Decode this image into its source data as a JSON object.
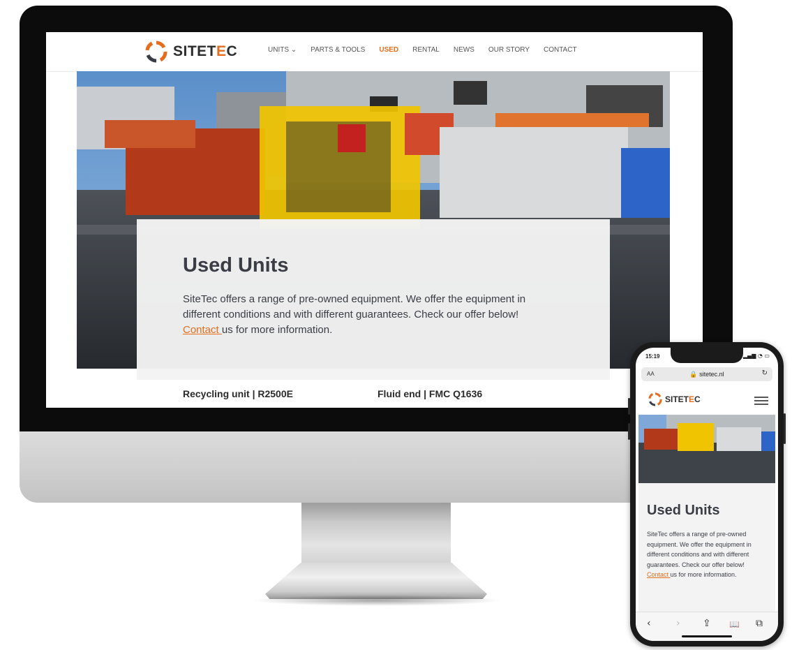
{
  "site": {
    "logo_text_dark": "SITET",
    "logo_text_accent": "E",
    "logo_text_end": "C",
    "nav": [
      {
        "label": "UNITS ⌄"
      },
      {
        "label": "PARTS & TOOLS"
      },
      {
        "label": "USED"
      },
      {
        "label": "RENTAL"
      },
      {
        "label": "NEWS"
      },
      {
        "label": "OUR STORY"
      },
      {
        "label": "CONTACT"
      }
    ],
    "hero": {
      "title": "Used Units",
      "text_before_link": "SiteTec offers a range of pre-owned equipment. We offer the equipment in different conditions and with different guarantees. Check our offer below!",
      "link": "Contact ",
      "text_after_link": "us for more information."
    },
    "products": [
      {
        "name": "Recycling unit | R2500E"
      },
      {
        "name": "Fluid end | FMC Q1636"
      }
    ],
    "accent_color": "#e56d1e"
  },
  "phone": {
    "status_time": "15:19",
    "url_aa": "AA",
    "url": "sitetec.nl",
    "logo_text_dark": "SITET",
    "logo_text_accent": "E",
    "logo_text_end": "C",
    "hero": {
      "title": "Used Units",
      "text_before_link": "SiteTec offers a range of pre-owned equipment. We offer the equipment in different conditions and with different guarantees. Check our offer below!",
      "link": "Contact ",
      "text_after_link": "us for more information."
    },
    "toolbar": {
      "back": "‹",
      "forward": "›",
      "share": "⇪",
      "bookmarks": "📖",
      "tabs": "⧉"
    }
  }
}
